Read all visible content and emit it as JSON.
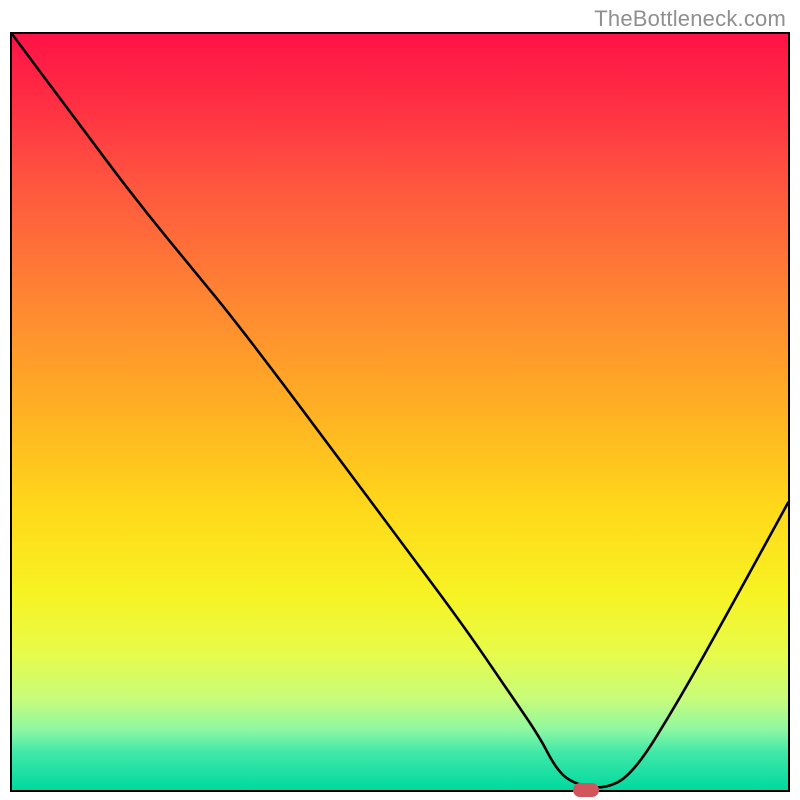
{
  "watermark": "TheBottleneck.com",
  "chart_data": {
    "type": "line",
    "title": "",
    "xlabel": "",
    "ylabel": "",
    "xlim": [
      0,
      100
    ],
    "ylim": [
      0,
      100
    ],
    "x": [
      0,
      8,
      16,
      24,
      28,
      34,
      42,
      50,
      58,
      64,
      68,
      70,
      72,
      76,
      80,
      86,
      92,
      100
    ],
    "values": [
      100,
      89,
      78,
      68,
      63,
      55,
      44,
      33,
      22,
      13,
      7,
      3,
      1,
      0,
      2,
      12,
      23,
      38
    ],
    "marker": {
      "x": 74,
      "y": 0,
      "color": "#d0555d"
    },
    "gradient_stops": [
      {
        "pos": 0,
        "color": "#ff1347"
      },
      {
        "pos": 20,
        "color": "#ff563f"
      },
      {
        "pos": 50,
        "color": "#ffb123"
      },
      {
        "pos": 74,
        "color": "#f7f323"
      },
      {
        "pos": 92,
        "color": "#8ef8a1"
      },
      {
        "pos": 100,
        "color": "#00d99f"
      }
    ]
  }
}
